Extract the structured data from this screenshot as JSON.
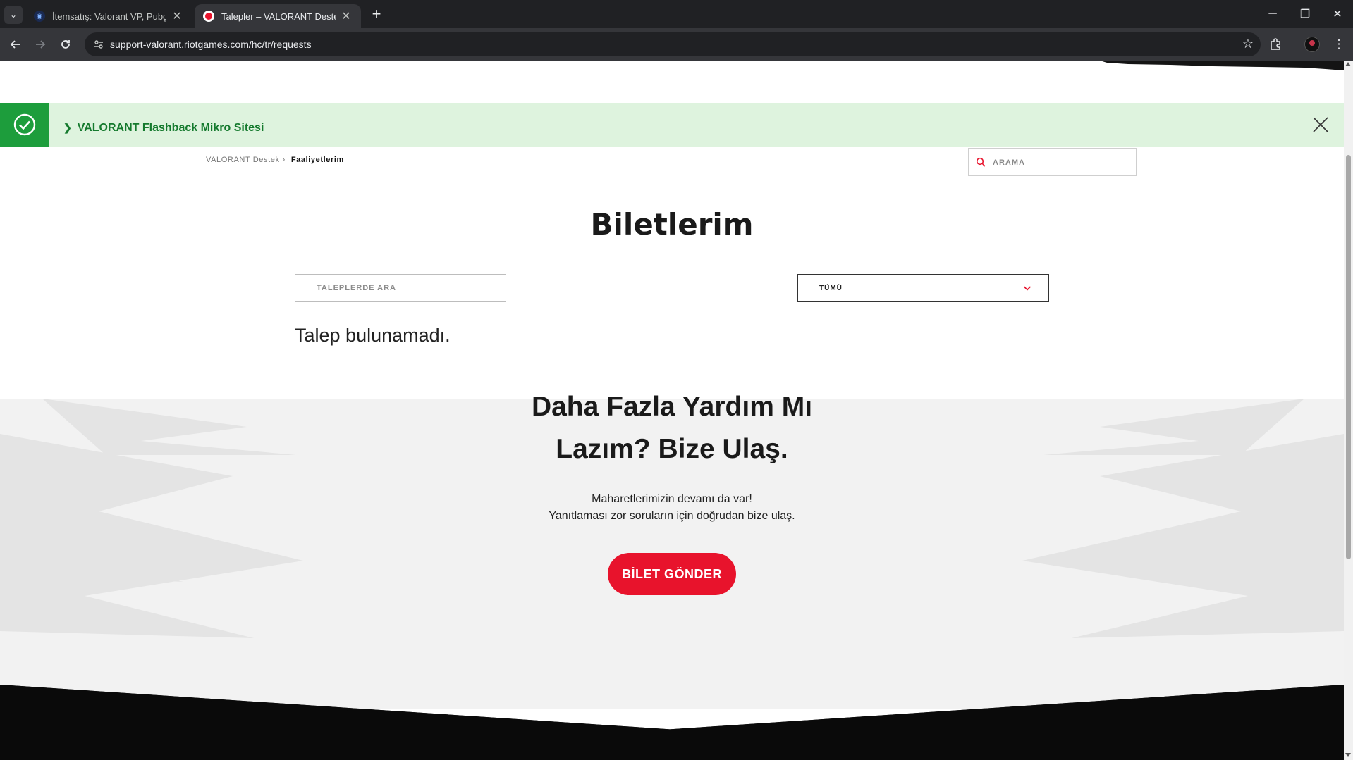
{
  "browser": {
    "tabs": [
      {
        "title": "İtemsatış: Valorant VP, Pubg M",
        "active": false
      },
      {
        "title": "Talepler – VALORANT Destek",
        "active": true
      }
    ],
    "url": "support-valorant.riotgames.com/hc/tr/requests",
    "icons": {
      "back": "arrow-left-icon",
      "forward": "arrow-right-icon",
      "reload": "reload-icon",
      "bookmark": "star-icon",
      "extensions": "puzzle-icon",
      "menu": "kebab-icon"
    }
  },
  "banner": {
    "text": "VALORANT Flashback Mikro Sitesi",
    "color": "#1d9d3c",
    "background": "#def3de"
  },
  "breadcrumb": {
    "root": "VALORANT Destek",
    "current": "Faaliyetlerim"
  },
  "header_search": {
    "placeholder": "ARAMA"
  },
  "page": {
    "title": "Biletlerim",
    "requests_search_placeholder": "TALEPLERDE ARA",
    "filter_value": "TÜMÜ",
    "empty_message": "Talep bulunamadı."
  },
  "help": {
    "title_line1": "Daha Fazla Yardım Mı",
    "title_line2": "Lazım? Bize Ulaş.",
    "subtitle_line1": "Maharetlerimizin devamı da var!",
    "subtitle_line2": "Yanıtlaması zor soruların için doğrudan bize ulaş.",
    "button": "BİLET GÖNDER",
    "accent": "#e8132c"
  }
}
